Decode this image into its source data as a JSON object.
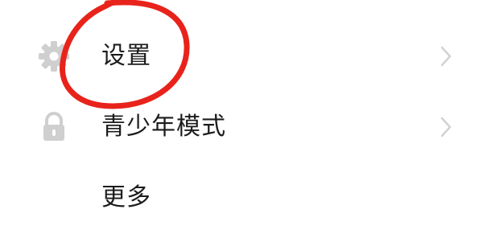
{
  "menu": {
    "items": [
      {
        "label": "设置",
        "icon": "gear-icon"
      },
      {
        "label": "青少年模式",
        "icon": "lock-icon"
      },
      {
        "label": "更多",
        "icon": "more-icon"
      }
    ]
  },
  "annotation": {
    "color": "#e8231b",
    "shape": "hand-drawn-circle"
  },
  "colors": {
    "icon": "#cfcfcf",
    "text": "#1c1c1c",
    "chevron": "#d2d2d2",
    "background": "#ffffff"
  }
}
